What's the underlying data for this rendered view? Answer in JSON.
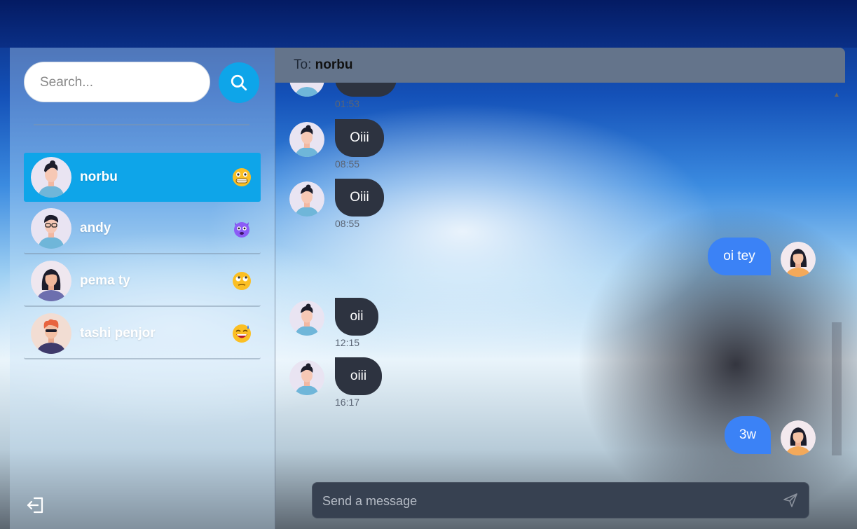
{
  "search": {
    "placeholder": "Search..."
  },
  "users": [
    {
      "name": "norbu",
      "status_icon": "grimacing-face-icon",
      "active": true
    },
    {
      "name": "andy",
      "status_icon": "smiling-devil-icon",
      "active": false
    },
    {
      "name": "pema ty",
      "status_icon": "face-with-rolling-eyes-icon",
      "active": false
    },
    {
      "name": "tashi penjor",
      "status_icon": "grinning-sweat-face-icon",
      "active": false
    }
  ],
  "chat": {
    "to_label": "To:",
    "recipient": "norbu",
    "messages": [
      {
        "direction": "in",
        "text": "",
        "time": "01:53"
      },
      {
        "direction": "in",
        "text": "Oiii",
        "time": "08:55"
      },
      {
        "direction": "in",
        "text": "Oiii",
        "time": "08:55"
      },
      {
        "direction": "out",
        "text": "oi tey",
        "time": ""
      },
      {
        "direction": "in",
        "text": "oii",
        "time": "12:15"
      },
      {
        "direction": "in",
        "text": "oiii",
        "time": "16:17"
      },
      {
        "direction": "out",
        "text": "3w",
        "time": ""
      }
    ]
  },
  "composer": {
    "placeholder": "Send a message"
  },
  "colors": {
    "accent": "#0ea5e9",
    "outgoing_bubble": "#3b82f6",
    "incoming_bubble": "#2d3340",
    "header": "#64748b"
  }
}
